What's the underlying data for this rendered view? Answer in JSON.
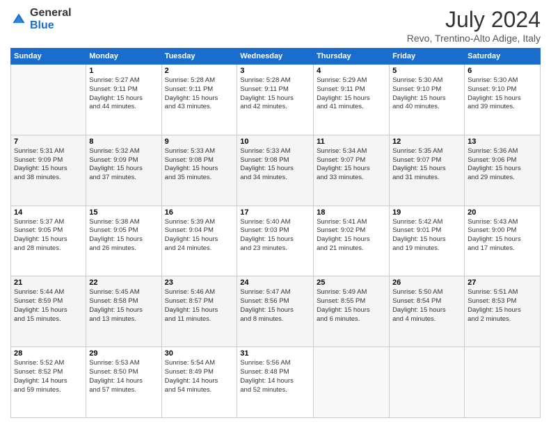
{
  "header": {
    "logo_line1": "General",
    "logo_line2": "Blue",
    "month_title": "July 2024",
    "location": "Revo, Trentino-Alto Adige, Italy"
  },
  "weekdays": [
    "Sunday",
    "Monday",
    "Tuesday",
    "Wednesday",
    "Thursday",
    "Friday",
    "Saturday"
  ],
  "weeks": [
    [
      {
        "day": "",
        "info": ""
      },
      {
        "day": "1",
        "info": "Sunrise: 5:27 AM\nSunset: 9:11 PM\nDaylight: 15 hours\nand 44 minutes."
      },
      {
        "day": "2",
        "info": "Sunrise: 5:28 AM\nSunset: 9:11 PM\nDaylight: 15 hours\nand 43 minutes."
      },
      {
        "day": "3",
        "info": "Sunrise: 5:28 AM\nSunset: 9:11 PM\nDaylight: 15 hours\nand 42 minutes."
      },
      {
        "day": "4",
        "info": "Sunrise: 5:29 AM\nSunset: 9:11 PM\nDaylight: 15 hours\nand 41 minutes."
      },
      {
        "day": "5",
        "info": "Sunrise: 5:30 AM\nSunset: 9:10 PM\nDaylight: 15 hours\nand 40 minutes."
      },
      {
        "day": "6",
        "info": "Sunrise: 5:30 AM\nSunset: 9:10 PM\nDaylight: 15 hours\nand 39 minutes."
      }
    ],
    [
      {
        "day": "7",
        "info": "Sunrise: 5:31 AM\nSunset: 9:09 PM\nDaylight: 15 hours\nand 38 minutes."
      },
      {
        "day": "8",
        "info": "Sunrise: 5:32 AM\nSunset: 9:09 PM\nDaylight: 15 hours\nand 37 minutes."
      },
      {
        "day": "9",
        "info": "Sunrise: 5:33 AM\nSunset: 9:08 PM\nDaylight: 15 hours\nand 35 minutes."
      },
      {
        "day": "10",
        "info": "Sunrise: 5:33 AM\nSunset: 9:08 PM\nDaylight: 15 hours\nand 34 minutes."
      },
      {
        "day": "11",
        "info": "Sunrise: 5:34 AM\nSunset: 9:07 PM\nDaylight: 15 hours\nand 33 minutes."
      },
      {
        "day": "12",
        "info": "Sunrise: 5:35 AM\nSunset: 9:07 PM\nDaylight: 15 hours\nand 31 minutes."
      },
      {
        "day": "13",
        "info": "Sunrise: 5:36 AM\nSunset: 9:06 PM\nDaylight: 15 hours\nand 29 minutes."
      }
    ],
    [
      {
        "day": "14",
        "info": "Sunrise: 5:37 AM\nSunset: 9:05 PM\nDaylight: 15 hours\nand 28 minutes."
      },
      {
        "day": "15",
        "info": "Sunrise: 5:38 AM\nSunset: 9:05 PM\nDaylight: 15 hours\nand 26 minutes."
      },
      {
        "day": "16",
        "info": "Sunrise: 5:39 AM\nSunset: 9:04 PM\nDaylight: 15 hours\nand 24 minutes."
      },
      {
        "day": "17",
        "info": "Sunrise: 5:40 AM\nSunset: 9:03 PM\nDaylight: 15 hours\nand 23 minutes."
      },
      {
        "day": "18",
        "info": "Sunrise: 5:41 AM\nSunset: 9:02 PM\nDaylight: 15 hours\nand 21 minutes."
      },
      {
        "day": "19",
        "info": "Sunrise: 5:42 AM\nSunset: 9:01 PM\nDaylight: 15 hours\nand 19 minutes."
      },
      {
        "day": "20",
        "info": "Sunrise: 5:43 AM\nSunset: 9:00 PM\nDaylight: 15 hours\nand 17 minutes."
      }
    ],
    [
      {
        "day": "21",
        "info": "Sunrise: 5:44 AM\nSunset: 8:59 PM\nDaylight: 15 hours\nand 15 minutes."
      },
      {
        "day": "22",
        "info": "Sunrise: 5:45 AM\nSunset: 8:58 PM\nDaylight: 15 hours\nand 13 minutes."
      },
      {
        "day": "23",
        "info": "Sunrise: 5:46 AM\nSunset: 8:57 PM\nDaylight: 15 hours\nand 11 minutes."
      },
      {
        "day": "24",
        "info": "Sunrise: 5:47 AM\nSunset: 8:56 PM\nDaylight: 15 hours\nand 8 minutes."
      },
      {
        "day": "25",
        "info": "Sunrise: 5:49 AM\nSunset: 8:55 PM\nDaylight: 15 hours\nand 6 minutes."
      },
      {
        "day": "26",
        "info": "Sunrise: 5:50 AM\nSunset: 8:54 PM\nDaylight: 15 hours\nand 4 minutes."
      },
      {
        "day": "27",
        "info": "Sunrise: 5:51 AM\nSunset: 8:53 PM\nDaylight: 15 hours\nand 2 minutes."
      }
    ],
    [
      {
        "day": "28",
        "info": "Sunrise: 5:52 AM\nSunset: 8:52 PM\nDaylight: 14 hours\nand 59 minutes."
      },
      {
        "day": "29",
        "info": "Sunrise: 5:53 AM\nSunset: 8:50 PM\nDaylight: 14 hours\nand 57 minutes."
      },
      {
        "day": "30",
        "info": "Sunrise: 5:54 AM\nSunset: 8:49 PM\nDaylight: 14 hours\nand 54 minutes."
      },
      {
        "day": "31",
        "info": "Sunrise: 5:56 AM\nSunset: 8:48 PM\nDaylight: 14 hours\nand 52 minutes."
      },
      {
        "day": "",
        "info": ""
      },
      {
        "day": "",
        "info": ""
      },
      {
        "day": "",
        "info": ""
      }
    ]
  ]
}
